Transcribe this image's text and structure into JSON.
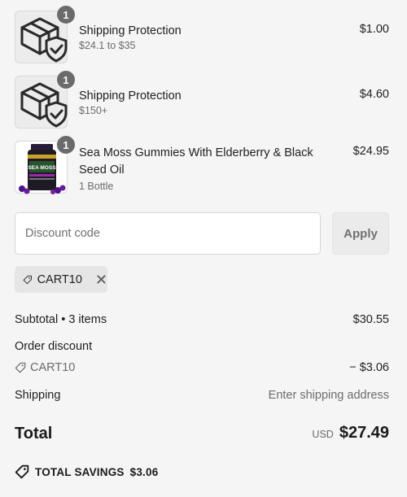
{
  "items": [
    {
      "name": "Shipping Protection",
      "variant": "$24.1 to $35",
      "price": "$1.00",
      "qty": "1",
      "image": "box-shield-icon"
    },
    {
      "name": "Shipping Protection",
      "variant": "$150+",
      "price": "$4.60",
      "qty": "1",
      "image": "box-shield-icon"
    },
    {
      "name": "Sea Moss Gummies With Elderberry & Black Seed Oil",
      "variant": "1 Bottle",
      "price": "$24.95",
      "qty": "1",
      "image": "supplement-bottle",
      "image_label": "SEA MOSS"
    }
  ],
  "discount": {
    "placeholder": "Discount code",
    "apply_label": "Apply"
  },
  "applied_code": {
    "code": "CART10"
  },
  "summary": {
    "subtotal_label": "Subtotal • 3 items",
    "subtotal_value": "$30.55",
    "order_discount_label": "Order discount",
    "discount_code": "CART10",
    "discount_value": "− $3.06",
    "shipping_label": "Shipping",
    "shipping_value": "Enter shipping address",
    "total_label": "Total",
    "total_currency": "USD",
    "total_value": "$27.49"
  },
  "savings": {
    "label": "TOTAL SAVINGS",
    "value": "$3.06"
  },
  "colors": {
    "background": "#f5f5f5",
    "badge": "#6b6b6b",
    "muted_text": "#6b6b6b"
  }
}
